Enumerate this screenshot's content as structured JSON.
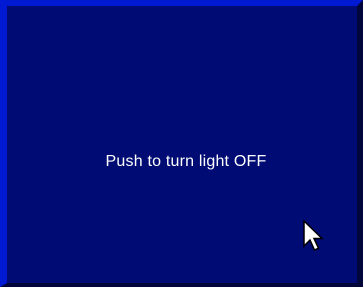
{
  "light_button": {
    "label": "Push to turn light OFF",
    "background_color": "#000b73",
    "highlight_color": "#0019d2"
  },
  "cursor": {
    "icon": "arrow-pointer-icon"
  }
}
